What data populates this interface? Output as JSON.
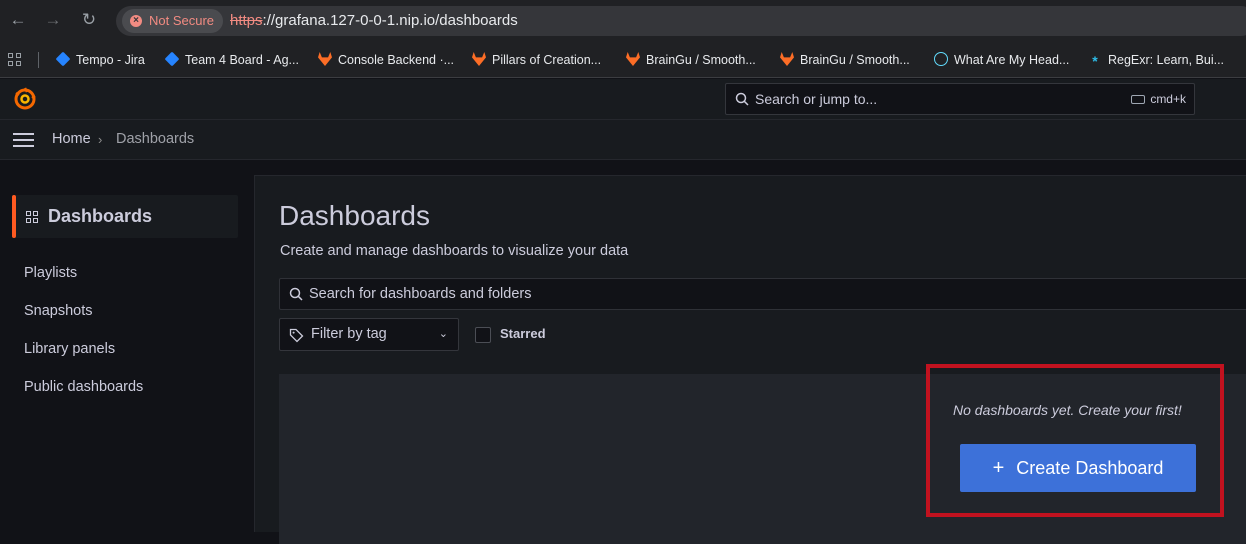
{
  "browser": {
    "not_secure": "Not Secure",
    "url_scheme": "https",
    "url_rest": "://grafana.127-0-0-1.nip.io/dashboards",
    "bookmarks": [
      {
        "label": "Tempo - Jira",
        "icon": "jira-icon"
      },
      {
        "label": "Team 4 Board - Ag...",
        "icon": "jira-icon"
      },
      {
        "label": "Console Backend ·...",
        "icon": "gitlab-icon"
      },
      {
        "label": "Pillars of Creation...",
        "icon": "gitlab-icon"
      },
      {
        "label": "BrainGu / Smooth...",
        "icon": "gitlab-icon"
      },
      {
        "label": "BrainGu / Smooth...",
        "icon": "gitlab-icon"
      },
      {
        "label": "What Are My Head...",
        "icon": "react-icon"
      },
      {
        "label": "RegExr: Learn, Bui...",
        "icon": "regex-icon"
      }
    ]
  },
  "topbar": {
    "search_placeholder": "Search or jump to...",
    "shortcut": "cmd+k"
  },
  "breadcrumb": {
    "home": "Home",
    "separator": "›",
    "current": "Dashboards"
  },
  "sidebar": {
    "active": "Dashboards",
    "items": [
      "Playlists",
      "Snapshots",
      "Library panels",
      "Public dashboards"
    ]
  },
  "main": {
    "title": "Dashboards",
    "subtitle": "Create and manage dashboards to visualize your data",
    "search_placeholder": "Search for dashboards and folders",
    "tag_filter": "Filter by tag",
    "starred": "Starred",
    "empty_message": "No dashboards yet. Create your first!",
    "create_button": "Create Dashboard",
    "create_icon": "+"
  },
  "colors": {
    "accent_orange": "#ff5a21",
    "primary_blue": "#3d71d9",
    "highlight_red": "#c1121f"
  }
}
